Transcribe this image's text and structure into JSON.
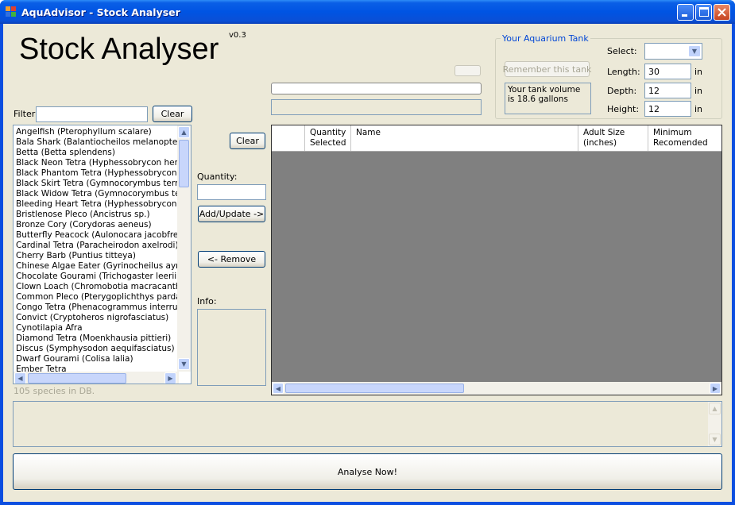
{
  "window": {
    "title": "AquAdvisor - Stock Analyser"
  },
  "header": {
    "title": "Stock Analyser",
    "version": "v0.3"
  },
  "filter": {
    "label": "Filter:",
    "value": "",
    "clear_label": "Clear"
  },
  "species_list": {
    "items": [
      {
        "label": "Angelfish   (Pterophyllum scalare)"
      },
      {
        "label": "Bala Shark   (Balantiocheilos melanopterus)"
      },
      {
        "label": "Betta   (Betta splendens)"
      },
      {
        "label": "Black Neon Tetra   (Hyphessobrycon herbe"
      },
      {
        "label": "Black Phantom Tetra   (Hyphessobrycon m"
      },
      {
        "label": "Black Skirt Tetra   (Gymnocorymbus ternetz"
      },
      {
        "label": "Black Widow Tetra   (Gymnocorymbus tern"
      },
      {
        "label": "Bleeding Heart Tetra   (Hyphessobrycon er"
      },
      {
        "label": "Bristlenose Pleco   (Ancistrus sp.)"
      },
      {
        "label": "Bronze Cory   (Corydoras aeneus)"
      },
      {
        "label": "Butterfly Peacock   (Aulonocara jacobfreibe"
      },
      {
        "label": "Cardinal Tetra   (Paracheirodon axelrodi)"
      },
      {
        "label": "Cherry Barb   (Puntius titteya)"
      },
      {
        "label": "Chinese Algae Eater   (Gyrinocheilus aymor"
      },
      {
        "label": "Chocolate Gourami   (Trichogaster leerii)"
      },
      {
        "label": "Clown Loach   (Chromobotia macracanthus"
      },
      {
        "label": "Common Pleco   (Pterygoplichthys pardalis)"
      },
      {
        "label": "Congo Tetra   (Phenacogrammus interrupt"
      },
      {
        "label": "Convict   (Cryptoheros nigrofasciatus)"
      },
      {
        "label": "Cynotilapia Afra"
      },
      {
        "label": "Diamond Tetra   (Moenkhausia pittieri)"
      },
      {
        "label": "Discus   (Symphysodon aequifasciatus)"
      },
      {
        "label": "Dwarf Gourami   (Colisa lalia)"
      },
      {
        "label": "Ember Tetra"
      }
    ],
    "count_text": "105 species in DB."
  },
  "stock_controls": {
    "clear_label": "Clear",
    "quantity_label": "Quantity:",
    "quantity_value": "",
    "add_label": "Add/Update ->",
    "remove_label": "<- Remove",
    "info_label": "Info:"
  },
  "tank": {
    "group_title": "Your Aquarium Tank",
    "remember_label": "Remember this tank",
    "volume_text": "Your tank volume is 18.6 gallons",
    "select_label": "Select:",
    "select_value": "",
    "length_label": "Length:",
    "length_value": "30",
    "depth_label": "Depth:",
    "depth_value": "12",
    "height_label": "Height:",
    "height_value": "12",
    "unit": "in"
  },
  "grid": {
    "columns": [
      "Quantity Selected",
      "Name",
      "Adult Size (inches)",
      "Minimum Recomended"
    ]
  },
  "progress": {
    "value": 0
  },
  "output": {
    "text": ""
  },
  "analyse": {
    "label": "Analyse Now!"
  },
  "colors": {
    "title_bar": "#0054e3",
    "grid_bg": "#808080",
    "group_title": "#0046d5"
  }
}
